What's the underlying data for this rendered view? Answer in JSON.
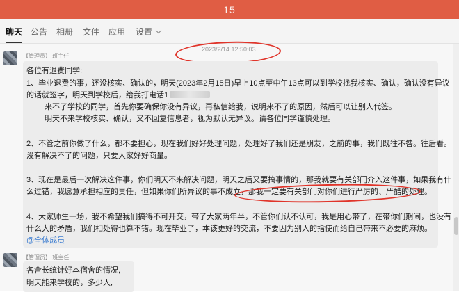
{
  "window": {
    "title": "15"
  },
  "tabs": [
    {
      "label": "聊天"
    },
    {
      "label": "公告"
    },
    {
      "label": "相册"
    },
    {
      "label": "文件"
    },
    {
      "label": "应用"
    },
    {
      "label": "设置"
    }
  ],
  "timestamp": "2023/2/14 12:50:03",
  "messages": [
    {
      "role": "【管理员】",
      "sender": "班主任",
      "lines": [
        "各位有退费同学:",
        "1、毕业退费的事，还没核实、确认的，明天(2023年2月15日)早上10点至中午13点可以到学校找我核实、确认，确认没有异议",
        "的话就签字，明天到学校后，给我打电话1",
        "来不了学校的同学，首先你要确保你没有异议，再私信给我，说明来不了的原因，然后可以让别人代签。",
        "明天不来学校核实、确认，又不回复信息者，视为默认无异议。请各位同学谨慎处理。",
        "2、不管之前你做了什么，都不要担心，现在我们好好处理问题，处理好了我们还是朋友，之前的事，我们既往不咎。往后看。",
        "没有解决不了的问题，只要大家好好商量。",
        "3、现在是最后一次解决这件事，你们明天不来解决问题，明天之后又要搞事情的，那我就要有关部门介入这件事，如果我有什",
        "么过错，我愿意承担相应的责任，但如果你们所异议的事不成立，",
        "那我一定要有关部门对你们进行严厉的、严酷的处理。",
        "4、大家师生一场，我不希望我们搞得不可开交，带了大家两年半，不管你们认不认可，我是用心带了，在带你们期间，也没有",
        "什么大的矛盾，我们相处得也算不错。现在毕业了，本该更好的交流，不要因为别人的指使而给自己带来不必要的麻烦。",
        "@全体成员"
      ]
    },
    {
      "role": "【管理员】",
      "sender": "班主任",
      "lines": [
        "各舍长统计好本宿舍的情况,",
        "明天能来学校的，多少人,"
      ]
    }
  ]
}
